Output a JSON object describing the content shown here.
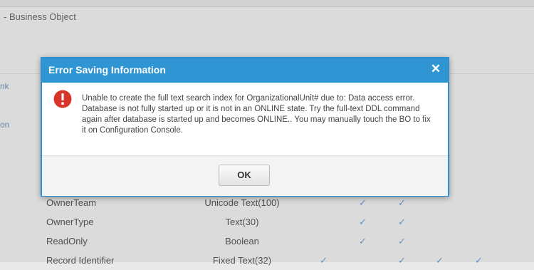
{
  "background": {
    "page_title": "- Business Object",
    "side_links": [
      "nk",
      "on"
    ],
    "rows": [
      {
        "name": "OwnerTeam",
        "type": "Unicode Text(100)"
      },
      {
        "name": "OwnerType",
        "type": "Text(30)"
      },
      {
        "name": "ReadOnly",
        "type": "Boolean"
      },
      {
        "name": "Record Identifier",
        "type": "Fixed Text(32)"
      }
    ],
    "check_glyph": "✓"
  },
  "dialog": {
    "title": "Error Saving Information",
    "close_glyph": "✕",
    "message": "Unable to create the full text search index for OrganizationalUnit# due to: Data access error. Database is not fully started up or it is not in an ONLINE state. Try the full-text DDL command again after database is started up and becomes ONLINE.. You may manually touch the BO to fix it on Configuration Console.",
    "ok_label": "OK",
    "icon": "error-circle-icon"
  },
  "colors": {
    "dialog_header": "#2f95d3",
    "error_icon": "#d9362b",
    "check": "#6b9ad0"
  }
}
